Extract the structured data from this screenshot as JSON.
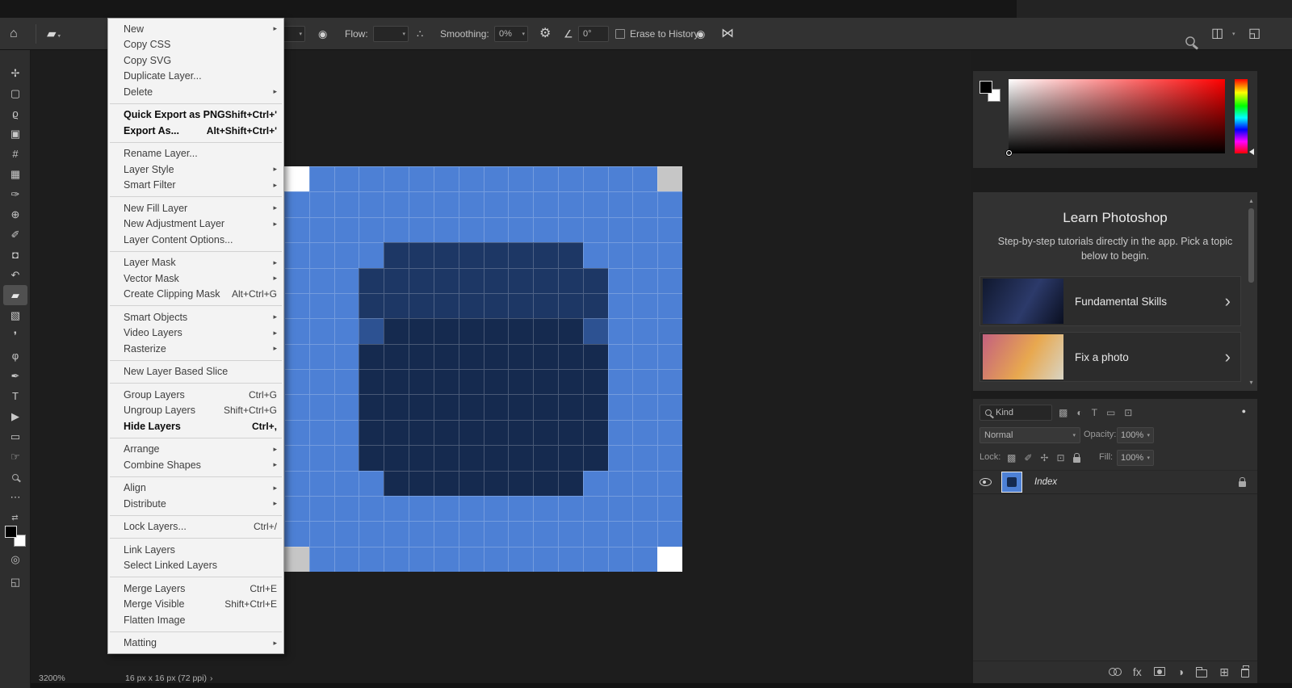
{
  "icons": {
    "home": "⌂",
    "eraser_preview": "▰",
    "dropdown_chevron": "▾",
    "submenu_arrow": "▸",
    "pressure_opacity": "◉",
    "pressure_size": "◉",
    "airbrush": "∴",
    "gear": "⚙",
    "angle": "∠",
    "symmetry": "⋈",
    "workspace": "◫",
    "dock": "◱",
    "swap": "⇄",
    "quick_mask": "◎",
    "screen_mode": "◱",
    "scroll_up": "▴",
    "scroll_down": "▾",
    "learn_chevron": "›",
    "status_chevron": "›",
    "toggle_dot": "●"
  },
  "options_bar": {
    "flow_label": "Flow:",
    "flow_value": "",
    "smoothing_label": "Smoothing:",
    "smoothing_value": "0%",
    "angle_value": "0°",
    "erase_history_label": "Erase to History"
  },
  "menu": {
    "items": [
      {
        "label": "New",
        "submenu": true
      },
      {
        "label": "Copy CSS"
      },
      {
        "label": "Copy SVG"
      },
      {
        "label": "Duplicate Layer..."
      },
      {
        "label": "Delete",
        "submenu": true
      },
      {
        "type": "separator"
      },
      {
        "label": "Quick Export as PNG",
        "shortcut": "Shift+Ctrl+'",
        "bold": true
      },
      {
        "label": "Export As...",
        "shortcut": "Alt+Shift+Ctrl+'",
        "bold": true
      },
      {
        "type": "separator"
      },
      {
        "label": "Rename Layer..."
      },
      {
        "label": "Layer Style",
        "submenu": true
      },
      {
        "label": "Smart Filter",
        "submenu": true
      },
      {
        "type": "separator"
      },
      {
        "label": "New Fill Layer",
        "submenu": true
      },
      {
        "label": "New Adjustment Layer",
        "submenu": true
      },
      {
        "label": "Layer Content Options..."
      },
      {
        "type": "separator"
      },
      {
        "label": "Layer Mask",
        "submenu": true
      },
      {
        "label": "Vector Mask",
        "submenu": true
      },
      {
        "label": "Create Clipping Mask",
        "shortcut": "Alt+Ctrl+G"
      },
      {
        "type": "separator"
      },
      {
        "label": "Smart Objects",
        "submenu": true
      },
      {
        "label": "Video Layers",
        "submenu": true
      },
      {
        "label": "Rasterize",
        "submenu": true
      },
      {
        "type": "separator"
      },
      {
        "label": "New Layer Based Slice"
      },
      {
        "type": "separator"
      },
      {
        "label": "Group Layers",
        "shortcut": "Ctrl+G"
      },
      {
        "label": "Ungroup Layers",
        "shortcut": "Shift+Ctrl+G"
      },
      {
        "label": "Hide Layers",
        "shortcut": "Ctrl+,",
        "bold": true
      },
      {
        "type": "separator"
      },
      {
        "label": "Arrange",
        "submenu": true
      },
      {
        "label": "Combine Shapes",
        "submenu": true
      },
      {
        "type": "separator"
      },
      {
        "label": "Align",
        "submenu": true
      },
      {
        "label": "Distribute",
        "submenu": true
      },
      {
        "type": "separator"
      },
      {
        "label": "Lock Layers...",
        "shortcut": "Ctrl+/"
      },
      {
        "type": "separator"
      },
      {
        "label": "Link Layers"
      },
      {
        "label": "Select Linked Layers"
      },
      {
        "type": "separator"
      },
      {
        "label": "Merge Layers",
        "shortcut": "Ctrl+E"
      },
      {
        "label": "Merge Visible",
        "shortcut": "Shift+Ctrl+E"
      },
      {
        "label": "Flatten Image"
      },
      {
        "type": "separator"
      },
      {
        "label": "Matting",
        "submenu": true
      }
    ]
  },
  "toolbar": {
    "tools": [
      {
        "name": "move-tool",
        "glyph": "✢"
      },
      {
        "name": "rectangular-marquee-tool",
        "glyph": "▢"
      },
      {
        "name": "lasso-tool",
        "glyph": "ϱ"
      },
      {
        "name": "object-selection-tool",
        "glyph": "▣"
      },
      {
        "name": "crop-tool",
        "glyph": "#"
      },
      {
        "name": "frame-tool",
        "glyph": "▦"
      },
      {
        "name": "eyedropper-tool",
        "glyph": "✑"
      },
      {
        "name": "spot-healing-brush-tool",
        "glyph": "⊕"
      },
      {
        "name": "brush-tool",
        "glyph": "✐"
      },
      {
        "name": "clone-stamp-tool",
        "glyph": "◘"
      },
      {
        "name": "history-brush-tool",
        "glyph": "↶"
      },
      {
        "name": "eraser-tool",
        "glyph": "▰",
        "selected": true
      },
      {
        "name": "gradient-tool",
        "glyph": "▧"
      },
      {
        "name": "blur-tool",
        "glyph": "❜"
      },
      {
        "name": "dodge-tool",
        "glyph": "φ"
      },
      {
        "name": "pen-tool",
        "glyph": "✒"
      },
      {
        "name": "type-tool",
        "glyph": "T"
      },
      {
        "name": "path-selection-tool",
        "glyph": "▶"
      },
      {
        "name": "rectangle-tool",
        "glyph": "▭"
      },
      {
        "name": "hand-tool",
        "glyph": "☞"
      },
      {
        "name": "zoom-tool",
        "glyph": "@mag"
      },
      {
        "name": "edit-toolbar-button",
        "glyph": "⋯"
      }
    ]
  },
  "canvas": {
    "zoom": "3200%",
    "doc_info": "16 px x 16 px (72 ppi)",
    "palette": {
      ".": "#4d80d5",
      "A": "#1d3765",
      "B": "#152a4f",
      "M": "#2d5292",
      "W": "#ffffff",
      "G": "#c6c6c6"
    },
    "grid": [
      "W..............G",
      "................",
      "................",
      "....AAAAAAAA....",
      "...AAAAAAAAAA...",
      "...AAAAAAAAAA...",
      "...MBBBBBBBBM...",
      "...BBBBBBBBBB...",
      "...BBBBBBBBBB...",
      "...BBBBBBBBBB...",
      "...BBBBBBBBBB...",
      "...BBBBBBBBBB...",
      "....BBBBBBBB....",
      "................",
      "................",
      "G..............W"
    ]
  },
  "learn_panel": {
    "title": "Learn Photoshop",
    "subtitle": "Step-by-step tutorials directly in the app. Pick a topic below to begin.",
    "items": [
      {
        "label": "Fundamental Skills",
        "thumb_colors": [
          "#10182e",
          "#2c3a6a",
          "#0a0f20"
        ]
      },
      {
        "label": "Fix a photo",
        "thumb_colors": [
          "#c4607f",
          "#e8a84f",
          "#d8d4c4"
        ]
      }
    ]
  },
  "layers_panel": {
    "filter_value": "Kind",
    "blend_mode": "Normal",
    "opacity_label": "Opacity:",
    "opacity_value": "100%",
    "lock_label": "Lock:",
    "fill_label": "Fill:",
    "fill_value": "100%",
    "layers": [
      {
        "name": "Index"
      }
    ],
    "filter_icons": [
      {
        "name": "filter-image-icon",
        "glyph": "▩"
      },
      {
        "name": "filter-adjustment-icon",
        "glyph": "◐"
      },
      {
        "name": "filter-type-icon",
        "glyph": "T"
      },
      {
        "name": "filter-shape-icon",
        "glyph": "▭"
      },
      {
        "name": "filter-smart-object-icon",
        "glyph": "⊡"
      }
    ],
    "lock_icons": [
      {
        "name": "lock-transparency-icon",
        "glyph": "▩"
      },
      {
        "name": "lock-paint-icon",
        "glyph": "✐"
      },
      {
        "name": "lock-position-icon",
        "glyph": "✢"
      },
      {
        "name": "lock-artboard-icon",
        "glyph": "⊡"
      },
      {
        "name": "lock-all-icon",
        "glyph": "@lock"
      }
    ],
    "bottom_icons": [
      {
        "name": "link-layers-icon",
        "glyph": "@link"
      },
      {
        "name": "layer-style-fx-icon",
        "glyph": "fx"
      },
      {
        "name": "add-layer-mask-icon",
        "glyph": "@mask"
      },
      {
        "name": "new-adjustment-layer-icon",
        "glyph": "◑"
      },
      {
        "name": "new-group-icon",
        "glyph": "@folder"
      },
      {
        "name": "new-layer-icon",
        "glyph": "⊞"
      },
      {
        "name": "delete-layer-icon",
        "glyph": "@trash"
      }
    ]
  }
}
